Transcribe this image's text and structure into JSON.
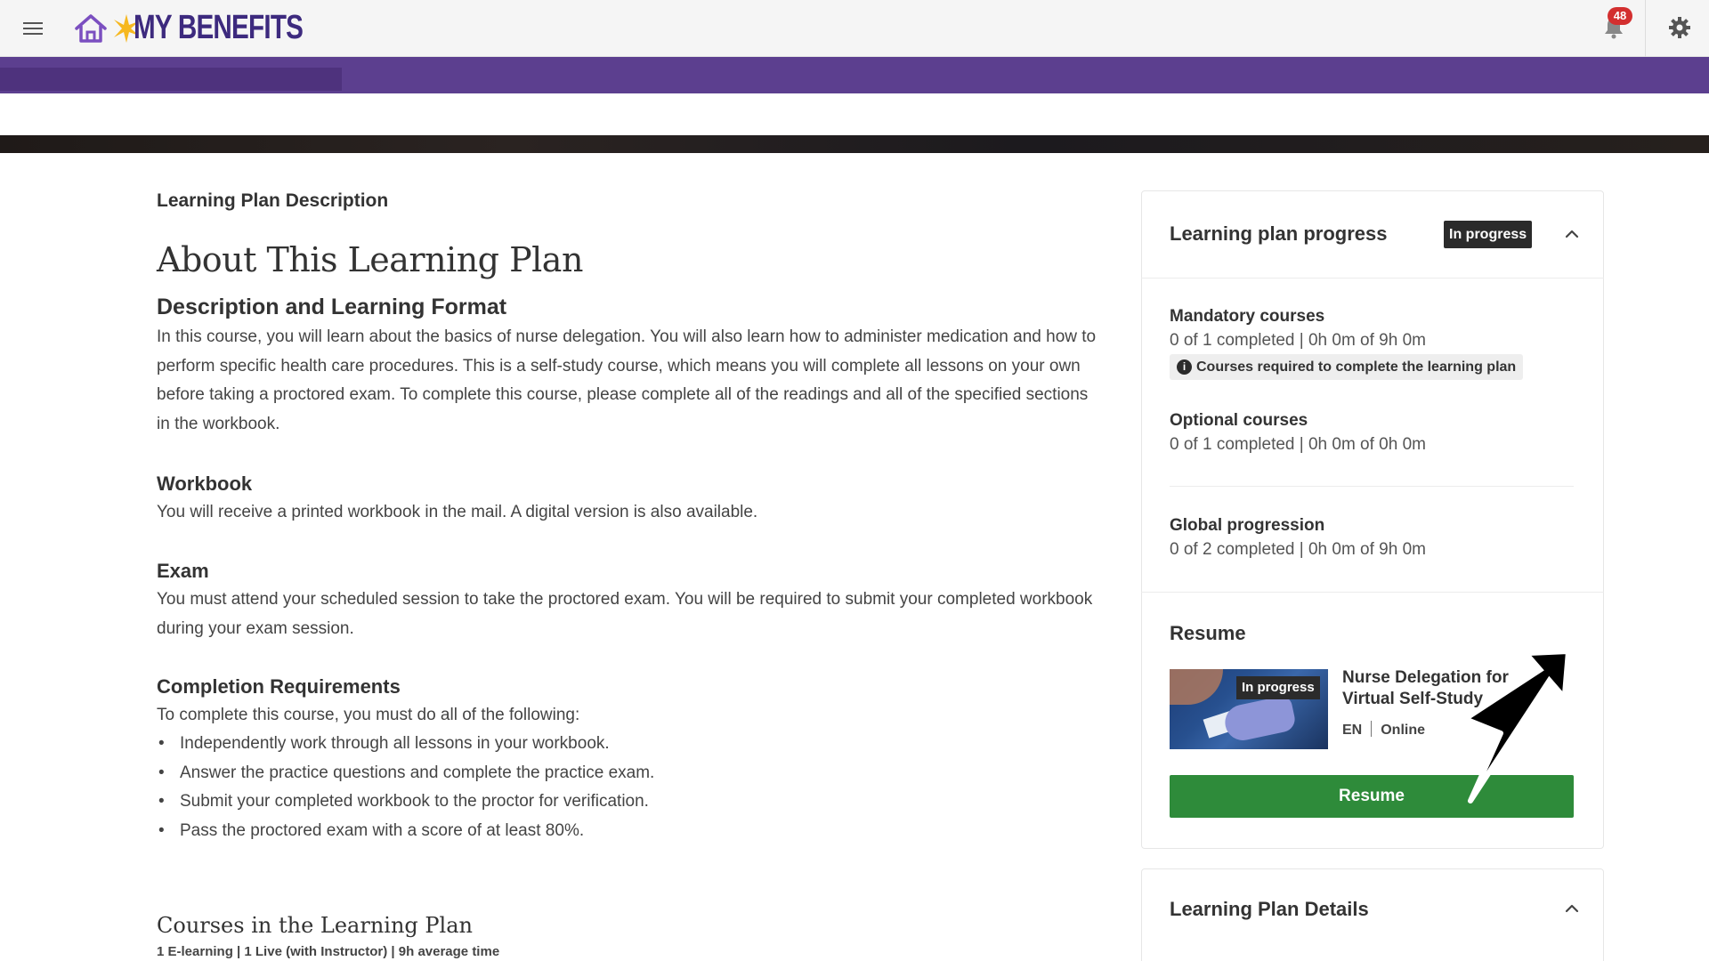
{
  "header": {
    "logo_text": "MY BENEFITS",
    "notification_count": "48"
  },
  "main": {
    "section_label": "Learning Plan Description",
    "about_title": "About This Learning Plan",
    "description_heading": "Description and Learning Format",
    "description_text": "In this course, you will learn about the basics of nurse delegation. You will also learn how to administer medication and how to perform specific health care procedures. This is a self-study course, which means you will complete all lessons on your own before taking a proctored exam. To complete this course, please complete all of the readings and all of the specified sections in the workbook.",
    "workbook_heading": "Workbook",
    "workbook_text": "You will receive a printed workbook in the mail. A digital version is also available.",
    "exam_heading": "Exam",
    "exam_text": "You must attend your scheduled session to take the proctored exam. You will be required to submit your completed workbook during your exam session.",
    "completion_heading": "Completion Requirements",
    "completion_intro": "To complete this course, you must do all of the following:",
    "completion_items": [
      "Independently work through all lessons in your workbook.",
      "Answer the practice questions and complete the practice exam.",
      "Submit your completed workbook to the proctor for verification.",
      "Pass the proctored exam with a score of at least 80%."
    ],
    "courses_title": "Courses in the Learning Plan",
    "courses_meta": "1 E-learning | 1 Live (with Instructor) | 9h average time"
  },
  "progress_card": {
    "title": "Learning plan progress",
    "status": "In progress",
    "mandatory_title": "Mandatory courses",
    "mandatory_value": "0 of 1 completed | 0h 0m of 9h 0m",
    "mandatory_note": "Courses required to complete the learning plan",
    "optional_title": "Optional courses",
    "optional_value": "0 of 1 completed | 0h 0m of 0h 0m",
    "global_title": "Global progression",
    "global_value": "0 of 2 completed | 0h 0m of 9h 0m",
    "resume_title": "Resume",
    "course_badge": "In progress",
    "course_name_line1": "Nurse Delegation for",
    "course_name_line2": "Virtual Self-Study",
    "course_lang": "EN",
    "course_mode": "Online",
    "resume_button": "Resume"
  },
  "details_card": {
    "title": "Learning Plan Details"
  },
  "colors": {
    "brand_purple": "#5c3f8f",
    "logo_text": "#3d2a7e",
    "resume_green": "#2e8b3a",
    "badge_red": "#d32f2f"
  },
  "icons": [
    "hamburger-menu-icon",
    "home-icon",
    "sun-logo-icon",
    "bell-icon",
    "gear-icon",
    "info-icon",
    "chevron-up-icon"
  ]
}
